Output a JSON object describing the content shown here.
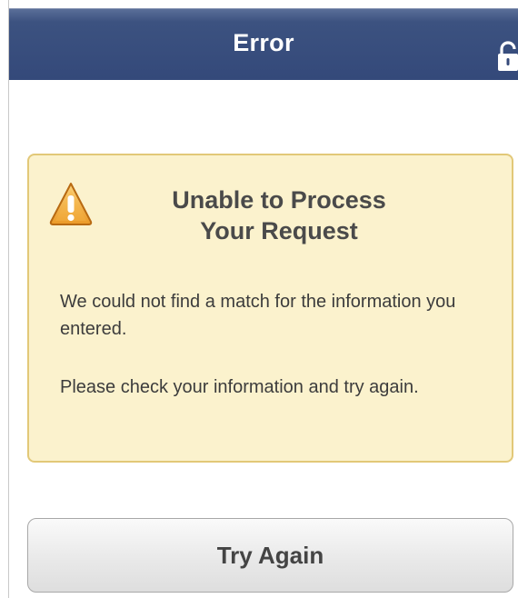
{
  "header": {
    "title": "Error",
    "lock_icon": "lock-icon"
  },
  "alert": {
    "icon": "warning-icon",
    "title_line1": "Unable to Process",
    "title_line2": "Your Request",
    "message1": "We could not find a match for the information you entered.",
    "message2": "Please check your information and try again.",
    "background_color": "#fbf2cd",
    "border_color": "#e2c878"
  },
  "actions": {
    "try_again_label": "Try Again"
  },
  "colors": {
    "header_bar": "#34497a",
    "warning_orange": "#f0a430"
  }
}
